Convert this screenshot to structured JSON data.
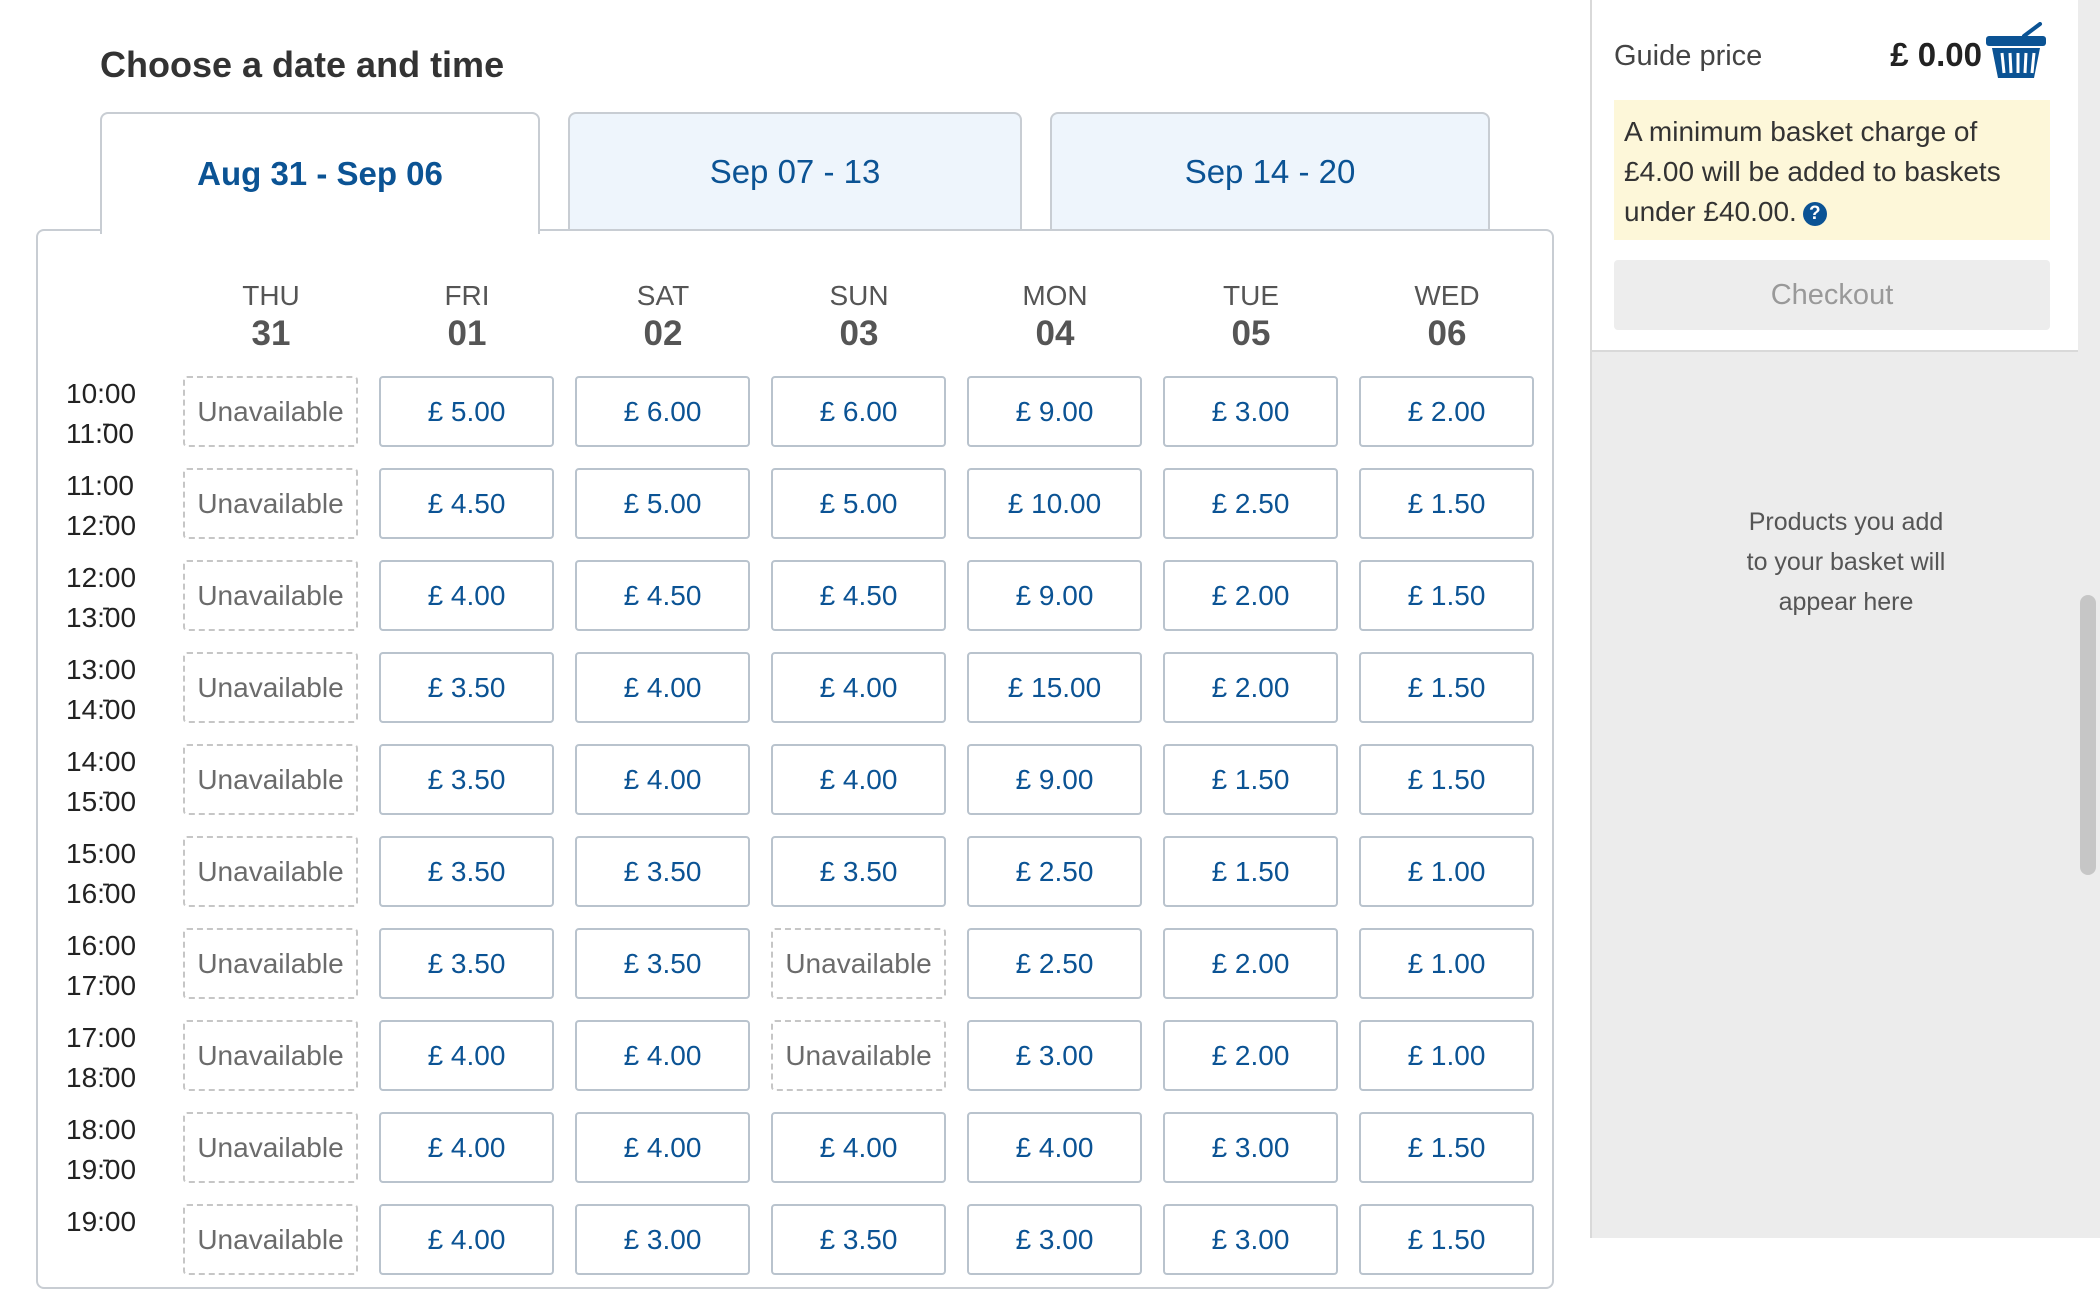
{
  "page": {
    "title": "Choose a date and time"
  },
  "tabs": [
    {
      "label": "Aug 31 - Sep 06",
      "active": true
    },
    {
      "label": "Sep 07 - 13",
      "active": false
    },
    {
      "label": "Sep 14 - 20",
      "active": false
    }
  ],
  "days": [
    {
      "name": "THU",
      "num": "31"
    },
    {
      "name": "FRI",
      "num": "01"
    },
    {
      "name": "SAT",
      "num": "02"
    },
    {
      "name": "SUN",
      "num": "03"
    },
    {
      "name": "MON",
      "num": "04"
    },
    {
      "name": "TUE",
      "num": "05"
    },
    {
      "name": "WED",
      "num": "06"
    }
  ],
  "rows": [
    {
      "start": "10:00",
      "end": "11:00",
      "slots": [
        "Unavailable",
        "£ 5.00",
        "£ 6.00",
        "£ 6.00",
        "£ 9.00",
        "£ 3.00",
        "£ 2.00"
      ]
    },
    {
      "start": "11:00",
      "end": "12:00",
      "slots": [
        "Unavailable",
        "£ 4.50",
        "£ 5.00",
        "£ 5.00",
        "£ 10.00",
        "£ 2.50",
        "£ 1.50"
      ]
    },
    {
      "start": "12:00",
      "end": "13:00",
      "slots": [
        "Unavailable",
        "£ 4.00",
        "£ 4.50",
        "£ 4.50",
        "£ 9.00",
        "£ 2.00",
        "£ 1.50"
      ]
    },
    {
      "start": "13:00",
      "end": "14:00",
      "slots": [
        "Unavailable",
        "£ 3.50",
        "£ 4.00",
        "£ 4.00",
        "£ 15.00",
        "£ 2.00",
        "£ 1.50"
      ]
    },
    {
      "start": "14:00",
      "end": "15:00",
      "slots": [
        "Unavailable",
        "£ 3.50",
        "£ 4.00",
        "£ 4.00",
        "£ 9.00",
        "£ 1.50",
        "£ 1.50"
      ]
    },
    {
      "start": "15:00",
      "end": "16:00",
      "slots": [
        "Unavailable",
        "£ 3.50",
        "£ 3.50",
        "£ 3.50",
        "£ 2.50",
        "£ 1.50",
        "£ 1.00"
      ]
    },
    {
      "start": "16:00",
      "end": "17:00",
      "slots": [
        "Unavailable",
        "£ 3.50",
        "£ 3.50",
        "Unavailable",
        "£ 2.50",
        "£ 2.00",
        "£ 1.00"
      ]
    },
    {
      "start": "17:00",
      "end": "18:00",
      "slots": [
        "Unavailable",
        "£ 4.00",
        "£ 4.00",
        "Unavailable",
        "£ 3.00",
        "£ 2.00",
        "£ 1.00"
      ]
    },
    {
      "start": "18:00",
      "end": "19:00",
      "slots": [
        "Unavailable",
        "£ 4.00",
        "£ 4.00",
        "£ 4.00",
        "£ 4.00",
        "£ 3.00",
        "£ 1.50"
      ]
    },
    {
      "start": "19:00",
      "end": "",
      "slots": [
        "Unavailable",
        "£ 4.00",
        "£ 3.00",
        "£ 3.50",
        "£ 3.00",
        "£ 3.00",
        "£ 1.50"
      ]
    }
  ],
  "sidebar": {
    "guide_label": "Guide price",
    "guide_price": "£ 0.00",
    "notice_text": "A minimum basket charge of £4.00 will be added to baskets under £40.00.",
    "help_glyph": "?",
    "checkout_label": "Checkout",
    "empty_lines": [
      "Products you add",
      "to your basket will",
      "appear here"
    ]
  },
  "colors": {
    "accent": "#0b5394",
    "tab_bg": "#eef5fc",
    "notice_bg": "#fdf7d9",
    "sidebar_bg": "#ececec"
  }
}
